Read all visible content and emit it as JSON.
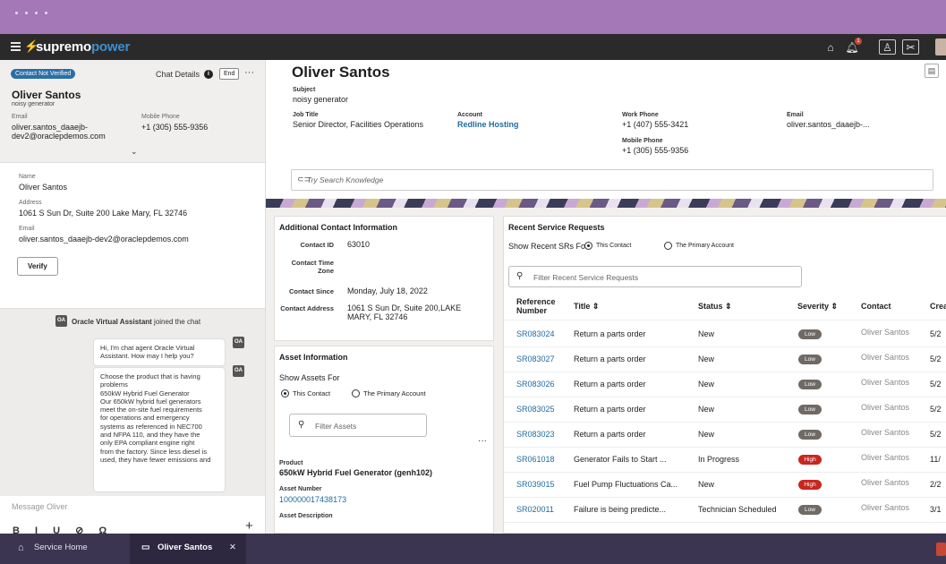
{
  "topbar": {
    "logo_prefix": "supremo",
    "logo_suffix": "power",
    "notification_count": "1"
  },
  "left": {
    "status_pill": "Contact Not Verified",
    "chat_details": "Chat Details",
    "end_label": "End",
    "more": "···",
    "contact_name": "Oliver Santos",
    "subject": "noisy generator",
    "email_label": "Email",
    "email_value_1": "oliver.santos_daaejb-",
    "email_value_2": "dev2@oraclepdemos.com",
    "mobile_label": "Mobile Phone",
    "mobile_value": "+1 (305) 555-9356",
    "name_label": "Name",
    "name_value": "Oliver Santos",
    "address_label": "Address",
    "address_value": "1061 S Sun Dr, Suite 200 Lake Mary, FL 32746",
    "email2_label": "Email",
    "email2_value": "oliver.santos_daaejb-dev2@oraclepdemos.com",
    "verify_label": "Verify",
    "oa": "OA",
    "system_message_name": "Oracle Virtual Assistant",
    "system_message_text": " joined the chat",
    "bubble1": "Hi, I'm chat agent Oracle Virtual Assistant. How may I help you?",
    "bubble2_lines": [
      "Choose the product that is having",
      "problems",
      "650kW Hybrid Fuel Generator",
      "Our 650kW hybrid fuel generators",
      "meet the on-site fuel requirements",
      "for operations and emergency",
      "systems as referenced in NEC700",
      "and NFPA 110, and they have the",
      "only EPA compliant engine right",
      "from the factory. Since less diesel is",
      "used, they have fewer emissions and"
    ],
    "message_placeholder": "Message Oliver",
    "format_tools": "B I U ⊘ Ω",
    "plus": "+"
  },
  "main": {
    "title": "Oliver Santos",
    "subject_label": "Subject",
    "subject_value": "noisy generator",
    "job_title_label": "Job Title",
    "job_title_value": "Senior Director, Facilities Operations",
    "account_label": "Account",
    "account_value": "Redline Hosting",
    "work_phone_label": "Work Phone",
    "work_phone_value": "+1 (407) 555-3421",
    "mobile_label": "Mobile Phone",
    "mobile_value": "+1 (305) 555-9356",
    "email_label": "Email",
    "email_value": "oliver.santos_daaejb-...",
    "knowledge_placeholder": "Try Search Knowledge"
  },
  "additional": {
    "title": "Additional Contact Information",
    "contact_id_label": "Contact ID",
    "contact_id_value": "63010",
    "time_zone_label_1": "Contact Time",
    "time_zone_label_2": "Zone",
    "since_label": "Contact Since",
    "since_value": "Monday, July 18, 2022",
    "address_label": "Contact Address",
    "address_value_1": "1061 S Sun Dr, Suite 200,LAKE",
    "address_value_2": "MARY, FL 32746"
  },
  "asset": {
    "title": "Asset Information",
    "show_for": "Show Assets For",
    "radio_contact": "This Contact",
    "radio_primary": "The Primary Account",
    "filter_placeholder": "Filter Assets",
    "more": "···",
    "product_label": "Product",
    "product_value": "650kW Hybrid Fuel Generator (genh102)",
    "asset_number_label": "Asset Number",
    "asset_number_value": "100000017438173",
    "asset_description_label": "Asset Description"
  },
  "sr": {
    "title": "Recent Service Requests",
    "show_for": "Show Recent SRs For",
    "radio_contact": "This Contact",
    "radio_primary": "The Primary Account",
    "filter_placeholder": "Filter Recent Service Requests",
    "headers": {
      "ref1": "Reference",
      "ref2": "Number",
      "title": "Title ⇕",
      "status": "Status ⇕",
      "severity": "Severity ⇕",
      "contact": "Contact",
      "created": "Crea"
    },
    "rows": [
      {
        "ref": "SR083024",
        "title": "Return a parts order",
        "status": "New",
        "severity": "Low",
        "contact": "Oliver Santos",
        "created": "5/2"
      },
      {
        "ref": "SR083027",
        "title": "Return a parts order",
        "status": "New",
        "severity": "Low",
        "contact": "Oliver Santos",
        "created": "5/2"
      },
      {
        "ref": "SR083026",
        "title": "Return a parts order",
        "status": "New",
        "severity": "Low",
        "contact": "Oliver Santos",
        "created": "5/2"
      },
      {
        "ref": "SR083025",
        "title": "Return a parts order",
        "status": "New",
        "severity": "Low",
        "contact": "Oliver Santos",
        "created": "5/2"
      },
      {
        "ref": "SR083023",
        "title": "Return a parts order",
        "status": "New",
        "severity": "Low",
        "contact": "Oliver Santos",
        "created": "5/2"
      },
      {
        "ref": "SR061018",
        "title": "Generator Fails to Start ...",
        "status": "In Progress",
        "severity": "High",
        "contact": "Oliver Santos",
        "created": "11/"
      },
      {
        "ref": "SR039015",
        "title": "Fuel Pump Fluctuations Ca...",
        "status": "New",
        "severity": "High",
        "contact": "Oliver Santos",
        "created": "2/2"
      },
      {
        "ref": "SR020011",
        "title": "Failure is being predicte...",
        "status": "Technician Scheduled",
        "severity": "Low",
        "contact": "Oliver Santos",
        "created": "3/1"
      }
    ]
  },
  "tabs": {
    "home": "Service Home",
    "contact": "Oliver Santos",
    "close": "✕"
  }
}
